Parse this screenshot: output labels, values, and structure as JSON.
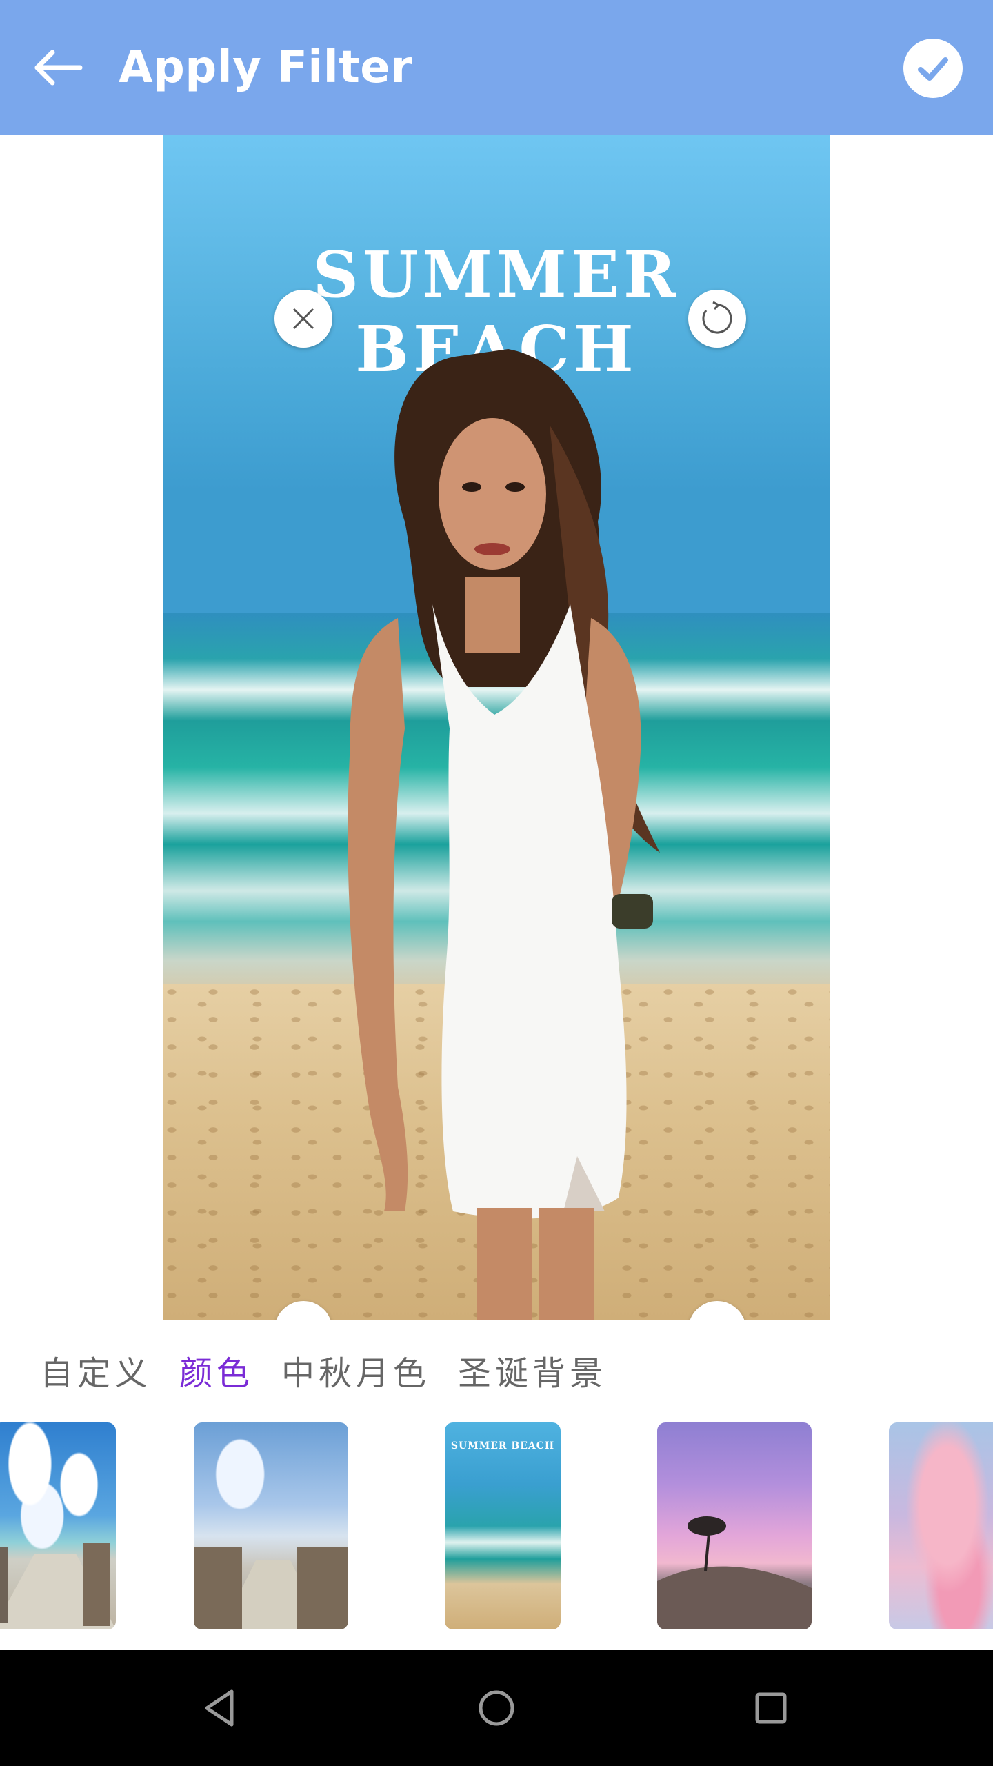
{
  "app_bar": {
    "title": "Apply Filter",
    "back_icon": "arrow-left-icon",
    "apply_icon": "check-icon",
    "background_color": "#7aa7ec"
  },
  "canvas": {
    "overlay_text": "SUMMER BEACH",
    "handles": [
      "close-icon",
      "rotate-icon",
      "resize-icon",
      "flip-icon"
    ]
  },
  "tabs": [
    {
      "label": "自定义",
      "active": false
    },
    {
      "label": "颜色",
      "active": true
    },
    {
      "label": "中秋月色",
      "active": false
    },
    {
      "label": "圣诞背景",
      "active": false
    }
  ],
  "active_tab_color": "#7a2bd6",
  "thumbnails": [
    {
      "name": "sky-boardwalk",
      "caption": ""
    },
    {
      "name": "cloudy-boardwalk",
      "caption": ""
    },
    {
      "name": "summer-beach",
      "caption": "SUMMER BEACH"
    },
    {
      "name": "purple-sunset-hill",
      "caption": ""
    },
    {
      "name": "pink-clouds",
      "caption": ""
    }
  ],
  "nav_bar": {
    "buttons": [
      "back-triangle-icon",
      "home-circle-icon",
      "recents-square-icon"
    ]
  }
}
